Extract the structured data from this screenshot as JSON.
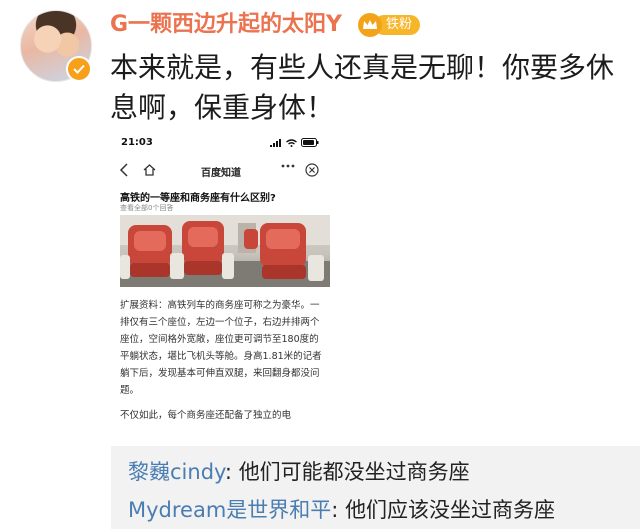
{
  "post": {
    "author": "G一颗西边升起的太阳Y",
    "badge_label": "铁粉",
    "text": "本来就是，有些人还真是无聊！你要多休息啊，保重身体！"
  },
  "embedded_screenshot": {
    "status_time": "21:03",
    "nav_title": "百度知道",
    "question_title": "高铁的一等座和商务座有什么区别?",
    "question_sub": "查看全部0个回答",
    "paragraph_1": "扩展资料：高铁列车的商务座可称之为豪华。一排仅有三个座位，左边一个位子，右边并排两个座位，空间格外宽敞，座位更可调节至180度的平躺状态，堪比飞机头等舱。身高1.81米的记者躺下后，发现基本可伸直双腿，来回翻身都没问题。",
    "paragraph_2": "不仅如此，每个商务座还配备了独立的电"
  },
  "comments": [
    {
      "author": "黎巍cindy",
      "separator": ": ",
      "text": "他们可能都没坐过商务座"
    },
    {
      "author": "Mydream是世界和平",
      "separator": ": ",
      "text": "他们应该没坐过商务座"
    }
  ],
  "colors": {
    "author_name": "#eb7350",
    "comment_author": "#4a7db2",
    "badge": "#f7b52a",
    "seat_red": "#c9463a"
  },
  "icons": [
    "verified-icon",
    "crown-icon",
    "back-icon",
    "home-icon",
    "more-icon",
    "close-icon",
    "signal-icon",
    "wifi-icon",
    "battery-icon"
  ]
}
